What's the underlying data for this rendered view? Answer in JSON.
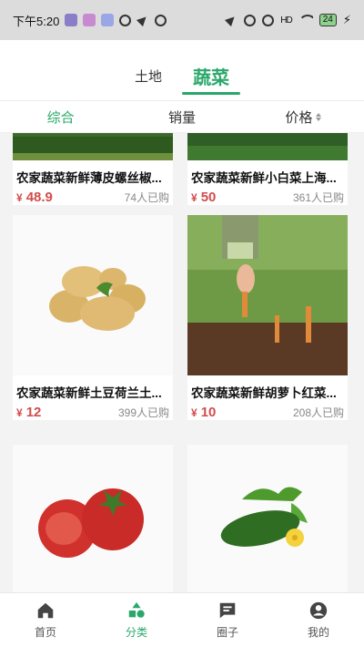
{
  "status": {
    "time": "下午5:20",
    "battery": "24",
    "network": "HD"
  },
  "top_tabs": [
    {
      "label": "土地",
      "active": false
    },
    {
      "label": "蔬菜",
      "active": true
    }
  ],
  "sort": [
    {
      "label": "综合",
      "active": true
    },
    {
      "label": "销量",
      "active": false
    },
    {
      "label": "价格",
      "active": false
    }
  ],
  "products": [
    {
      "title": "农家蔬菜新鲜薄皮螺丝椒...",
      "currency": "¥",
      "price": "48.9",
      "sold": "74人已购"
    },
    {
      "title": "农家蔬菜新鲜小白菜上海...",
      "currency": "¥",
      "price": "50",
      "sold": "361人已购"
    },
    {
      "title": "农家蔬菜新鲜土豆荷兰土...",
      "currency": "¥",
      "price": "12",
      "sold": "399人已购"
    },
    {
      "title": "农家蔬菜新鲜胡萝卜红菜...",
      "currency": "¥",
      "price": "10",
      "sold": "208人已购"
    }
  ],
  "nav": [
    {
      "label": "首页",
      "icon": "home-icon",
      "active": false
    },
    {
      "label": "分类",
      "icon": "category-icon",
      "active": true
    },
    {
      "label": "圈子",
      "icon": "chat-icon",
      "active": false
    },
    {
      "label": "我的",
      "icon": "profile-icon",
      "active": false
    }
  ],
  "colors": {
    "accent": "#2aa86a",
    "price": "#d24c4c"
  }
}
